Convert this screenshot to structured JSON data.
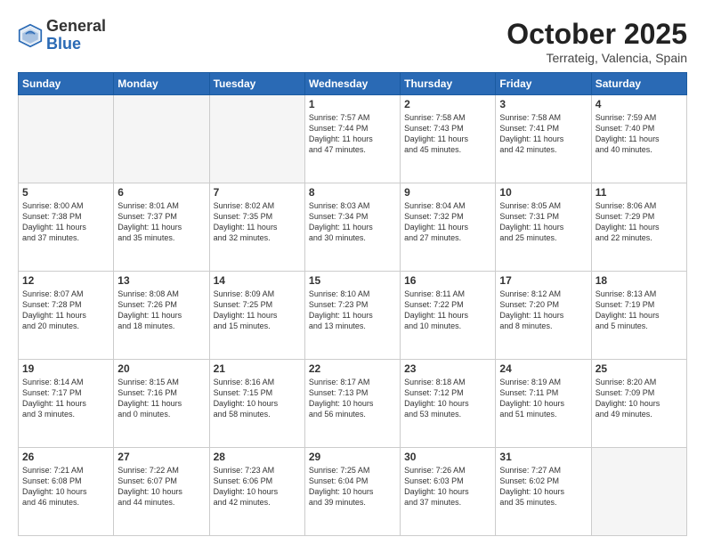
{
  "header": {
    "logo_general": "General",
    "logo_blue": "Blue",
    "month": "October 2025",
    "location": "Terrateig, Valencia, Spain"
  },
  "days_of_week": [
    "Sunday",
    "Monday",
    "Tuesday",
    "Wednesday",
    "Thursday",
    "Friday",
    "Saturday"
  ],
  "weeks": [
    [
      {
        "num": "",
        "info": ""
      },
      {
        "num": "",
        "info": ""
      },
      {
        "num": "",
        "info": ""
      },
      {
        "num": "1",
        "info": "Sunrise: 7:57 AM\nSunset: 7:44 PM\nDaylight: 11 hours\nand 47 minutes."
      },
      {
        "num": "2",
        "info": "Sunrise: 7:58 AM\nSunset: 7:43 PM\nDaylight: 11 hours\nand 45 minutes."
      },
      {
        "num": "3",
        "info": "Sunrise: 7:58 AM\nSunset: 7:41 PM\nDaylight: 11 hours\nand 42 minutes."
      },
      {
        "num": "4",
        "info": "Sunrise: 7:59 AM\nSunset: 7:40 PM\nDaylight: 11 hours\nand 40 minutes."
      }
    ],
    [
      {
        "num": "5",
        "info": "Sunrise: 8:00 AM\nSunset: 7:38 PM\nDaylight: 11 hours\nand 37 minutes."
      },
      {
        "num": "6",
        "info": "Sunrise: 8:01 AM\nSunset: 7:37 PM\nDaylight: 11 hours\nand 35 minutes."
      },
      {
        "num": "7",
        "info": "Sunrise: 8:02 AM\nSunset: 7:35 PM\nDaylight: 11 hours\nand 32 minutes."
      },
      {
        "num": "8",
        "info": "Sunrise: 8:03 AM\nSunset: 7:34 PM\nDaylight: 11 hours\nand 30 minutes."
      },
      {
        "num": "9",
        "info": "Sunrise: 8:04 AM\nSunset: 7:32 PM\nDaylight: 11 hours\nand 27 minutes."
      },
      {
        "num": "10",
        "info": "Sunrise: 8:05 AM\nSunset: 7:31 PM\nDaylight: 11 hours\nand 25 minutes."
      },
      {
        "num": "11",
        "info": "Sunrise: 8:06 AM\nSunset: 7:29 PM\nDaylight: 11 hours\nand 22 minutes."
      }
    ],
    [
      {
        "num": "12",
        "info": "Sunrise: 8:07 AM\nSunset: 7:28 PM\nDaylight: 11 hours\nand 20 minutes."
      },
      {
        "num": "13",
        "info": "Sunrise: 8:08 AM\nSunset: 7:26 PM\nDaylight: 11 hours\nand 18 minutes."
      },
      {
        "num": "14",
        "info": "Sunrise: 8:09 AM\nSunset: 7:25 PM\nDaylight: 11 hours\nand 15 minutes."
      },
      {
        "num": "15",
        "info": "Sunrise: 8:10 AM\nSunset: 7:23 PM\nDaylight: 11 hours\nand 13 minutes."
      },
      {
        "num": "16",
        "info": "Sunrise: 8:11 AM\nSunset: 7:22 PM\nDaylight: 11 hours\nand 10 minutes."
      },
      {
        "num": "17",
        "info": "Sunrise: 8:12 AM\nSunset: 7:20 PM\nDaylight: 11 hours\nand 8 minutes."
      },
      {
        "num": "18",
        "info": "Sunrise: 8:13 AM\nSunset: 7:19 PM\nDaylight: 11 hours\nand 5 minutes."
      }
    ],
    [
      {
        "num": "19",
        "info": "Sunrise: 8:14 AM\nSunset: 7:17 PM\nDaylight: 11 hours\nand 3 minutes."
      },
      {
        "num": "20",
        "info": "Sunrise: 8:15 AM\nSunset: 7:16 PM\nDaylight: 11 hours\nand 0 minutes."
      },
      {
        "num": "21",
        "info": "Sunrise: 8:16 AM\nSunset: 7:15 PM\nDaylight: 10 hours\nand 58 minutes."
      },
      {
        "num": "22",
        "info": "Sunrise: 8:17 AM\nSunset: 7:13 PM\nDaylight: 10 hours\nand 56 minutes."
      },
      {
        "num": "23",
        "info": "Sunrise: 8:18 AM\nSunset: 7:12 PM\nDaylight: 10 hours\nand 53 minutes."
      },
      {
        "num": "24",
        "info": "Sunrise: 8:19 AM\nSunset: 7:11 PM\nDaylight: 10 hours\nand 51 minutes."
      },
      {
        "num": "25",
        "info": "Sunrise: 8:20 AM\nSunset: 7:09 PM\nDaylight: 10 hours\nand 49 minutes."
      }
    ],
    [
      {
        "num": "26",
        "info": "Sunrise: 7:21 AM\nSunset: 6:08 PM\nDaylight: 10 hours\nand 46 minutes."
      },
      {
        "num": "27",
        "info": "Sunrise: 7:22 AM\nSunset: 6:07 PM\nDaylight: 10 hours\nand 44 minutes."
      },
      {
        "num": "28",
        "info": "Sunrise: 7:23 AM\nSunset: 6:06 PM\nDaylight: 10 hours\nand 42 minutes."
      },
      {
        "num": "29",
        "info": "Sunrise: 7:25 AM\nSunset: 6:04 PM\nDaylight: 10 hours\nand 39 minutes."
      },
      {
        "num": "30",
        "info": "Sunrise: 7:26 AM\nSunset: 6:03 PM\nDaylight: 10 hours\nand 37 minutes."
      },
      {
        "num": "31",
        "info": "Sunrise: 7:27 AM\nSunset: 6:02 PM\nDaylight: 10 hours\nand 35 minutes."
      },
      {
        "num": "",
        "info": ""
      }
    ]
  ]
}
